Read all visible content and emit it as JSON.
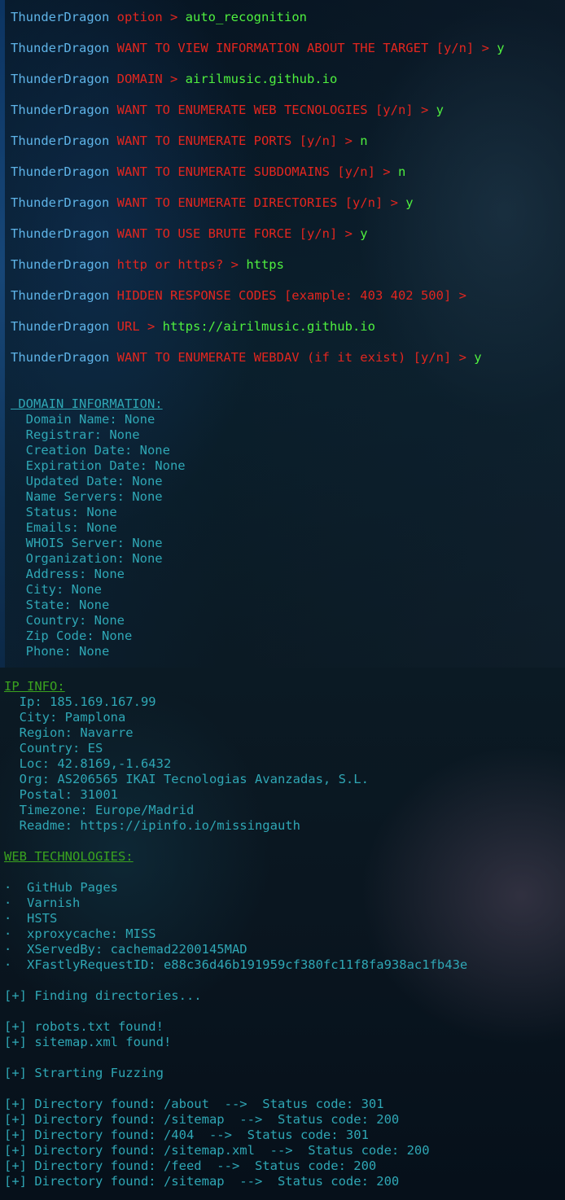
{
  "prompt_user": "ThunderDragon",
  "prompts": [
    {
      "question": "option > ",
      "answer": "auto_recognition"
    },
    {
      "question": "WANT TO VIEW INFORMATION ABOUT THE TARGET [y/n] > ",
      "answer": "y"
    },
    {
      "question": "DOMAIN > ",
      "answer": "airilmusic.github.io"
    },
    {
      "question": "WANT TO ENUMERATE WEB TECNOLOGIES [y/n] > ",
      "answer": "y"
    },
    {
      "question": "WANT TO ENUMERATE PORTS [y/n] > ",
      "answer": "n"
    },
    {
      "question": "WANT TO ENUMERATE SUBDOMAINS [y/n] > ",
      "answer": "n"
    },
    {
      "question": "WANT TO ENUMERATE DIRECTORIES [y/n] > ",
      "answer": "y"
    },
    {
      "question": "WANT TO USE BRUTE FORCE [y/n] > ",
      "answer": "y"
    },
    {
      "question": "http or https? > ",
      "answer": "https"
    },
    {
      "question": "HIDDEN RESPONSE CODES [example: 403 402 500] > ",
      "answer": ""
    },
    {
      "question": "URL > ",
      "answer": "https://airilmusic.github.io"
    },
    {
      "question": "WANT TO ENUMERATE WEBDAV (if it exist) [y/n] > ",
      "answer": "y"
    }
  ],
  "domain_information": {
    "heading": " DOMAIN INFORMATION:",
    "rows": [
      "  Domain Name: None",
      "  Registrar: None",
      "  Creation Date: None",
      "  Expiration Date: None",
      "  Updated Date: None",
      "  Name Servers: None",
      "  Status: None",
      "  Emails: None",
      "  WHOIS Server: None",
      "  Organization: None",
      "  Address: None",
      "  City: None",
      "  State: None",
      "  Country: None",
      "  Zip Code: None",
      "  Phone: None"
    ]
  },
  "ip_info": {
    "heading": "IP INFO:",
    "rows": [
      "  Ip: 185.169.167.99",
      "  City: Pamplona",
      "  Region: Navarre",
      "  Country: ES",
      "  Loc: 42.8169,-1.6432",
      "  Org: AS206565 IKAI Tecnologias Avanzadas, S.L.",
      "  Postal: 31001",
      "  Timezone: Europe/Madrid",
      "  Readme: https://ipinfo.io/missingauth"
    ]
  },
  "web_technologies": {
    "heading": "WEB TECHNOLOGIES:",
    "rows": [
      "·  GitHub Pages",
      "·  Varnish",
      "·  HSTS",
      "·  xproxycache: MISS",
      "·  XServedBy: cachemad2200145MAD",
      "·  XFastlyRequestID: e88c36d46b191959cf380fc11f8fa938ac1fb43e"
    ]
  },
  "output": {
    "finding": "[+] Finding directories...",
    "robots": "[+] robots.txt found!",
    "sitemap": "[+] sitemap.xml found!",
    "fuzzing": "[+] Strarting Fuzzing",
    "directories": [
      "[+] Directory found: /about  -->  Status code: 301",
      "[+] Directory found: /sitemap  -->  Status code: 200",
      "[+] Directory found: /404  -->  Status code: 301",
      "[+] Directory found: /sitemap.xml  -->  Status code: 200",
      "[+] Directory found: /feed  -->  Status code: 200",
      "[+] Directory found: /sitemap  -->  Status code: 200"
    ]
  }
}
